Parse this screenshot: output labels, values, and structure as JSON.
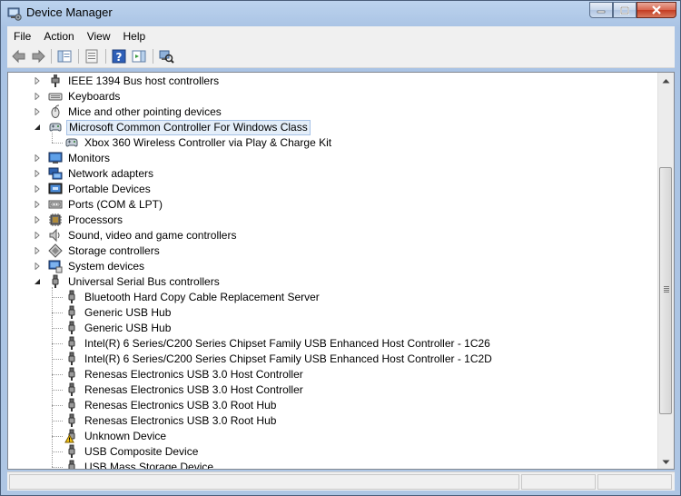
{
  "window": {
    "title": "Device Manager"
  },
  "menu": [
    {
      "label": "File"
    },
    {
      "label": "Action"
    },
    {
      "label": "View"
    },
    {
      "label": "Help"
    }
  ],
  "tree": {
    "categories": [
      {
        "label": "IEEE 1394 Bus host controllers",
        "icon": "ieee1394-icon",
        "expanded": false
      },
      {
        "label": "Keyboards",
        "icon": "keyboard-icon",
        "expanded": false
      },
      {
        "label": "Mice and other pointing devices",
        "icon": "mouse-icon",
        "expanded": false
      },
      {
        "label": "Microsoft Common Controller For Windows Class",
        "icon": "gamepad-icon",
        "expanded": true,
        "selected": true,
        "children": [
          {
            "label": "Xbox 360 Wireless Controller via Play & Charge Kit",
            "icon": "gamepad-icon"
          }
        ]
      },
      {
        "label": "Monitors",
        "icon": "monitor-icon",
        "expanded": false
      },
      {
        "label": "Network adapters",
        "icon": "network-adapter-icon",
        "expanded": false
      },
      {
        "label": "Portable Devices",
        "icon": "portable-device-icon",
        "expanded": false
      },
      {
        "label": "Ports (COM & LPT)",
        "icon": "port-icon",
        "expanded": false
      },
      {
        "label": "Processors",
        "icon": "processor-icon",
        "expanded": false
      },
      {
        "label": "Sound, video and game controllers",
        "icon": "speaker-icon",
        "expanded": false
      },
      {
        "label": "Storage controllers",
        "icon": "storage-controller-icon",
        "expanded": false
      },
      {
        "label": "System devices",
        "icon": "system-device-icon",
        "expanded": false
      },
      {
        "label": "Universal Serial Bus controllers",
        "icon": "usb-plug-icon",
        "expanded": true,
        "children": [
          {
            "label": "Bluetooth Hard Copy Cable Replacement Server",
            "icon": "usb-plug-icon"
          },
          {
            "label": "Generic USB Hub",
            "icon": "usb-plug-icon"
          },
          {
            "label": "Generic USB Hub",
            "icon": "usb-plug-icon"
          },
          {
            "label": "Intel(R) 6 Series/C200 Series Chipset Family USB Enhanced Host Controller - 1C26",
            "icon": "usb-plug-icon"
          },
          {
            "label": "Intel(R) 6 Series/C200 Series Chipset Family USB Enhanced Host Controller - 1C2D",
            "icon": "usb-plug-icon"
          },
          {
            "label": "Renesas Electronics USB 3.0 Host Controller",
            "icon": "usb-plug-icon"
          },
          {
            "label": "Renesas Electronics USB 3.0 Host Controller",
            "icon": "usb-plug-icon"
          },
          {
            "label": "Renesas Electronics USB 3.0 Root Hub",
            "icon": "usb-plug-icon"
          },
          {
            "label": "Renesas Electronics USB 3.0 Root Hub",
            "icon": "usb-plug-icon"
          },
          {
            "label": "Unknown Device",
            "icon": "warning-icon"
          },
          {
            "label": "USB Composite Device",
            "icon": "usb-plug-icon"
          },
          {
            "label": "USB Mass Storage Device",
            "icon": "usb-plug-icon"
          }
        ]
      }
    ]
  },
  "colors": {
    "selection_fill": "#e4eef9",
    "selection_border": "#a6c1e6",
    "frame": "#aec6e4",
    "close": "#c33b22"
  }
}
